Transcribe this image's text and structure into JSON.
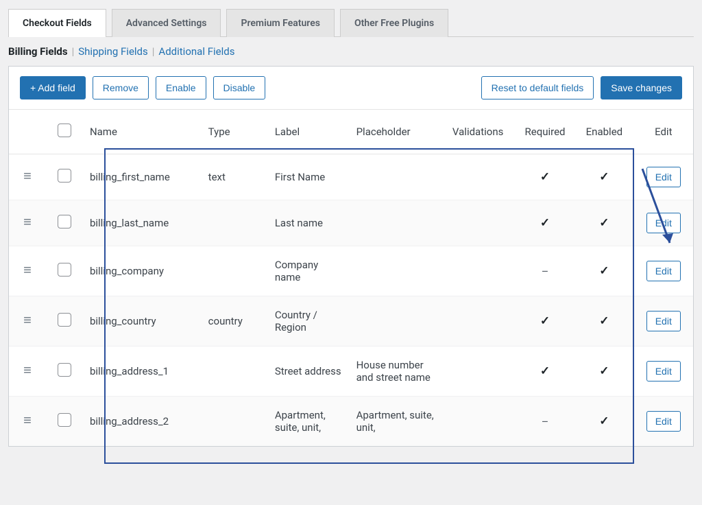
{
  "tabs": [
    {
      "label": "Checkout Fields",
      "active": true
    },
    {
      "label": "Advanced Settings",
      "active": false
    },
    {
      "label": "Premium Features",
      "active": false
    },
    {
      "label": "Other Free Plugins",
      "active": false
    }
  ],
  "subnav": {
    "current": "Billing Fields",
    "links": [
      "Shipping Fields",
      "Additional Fields"
    ]
  },
  "toolbar": {
    "add": "+ Add field",
    "remove": "Remove",
    "enable": "Enable",
    "disable": "Disable",
    "reset": "Reset to default fields",
    "save": "Save changes"
  },
  "columns": {
    "name": "Name",
    "type": "Type",
    "label": "Label",
    "placeholder": "Placeholder",
    "validations": "Validations",
    "required": "Required",
    "enabled": "Enabled",
    "edit": "Edit"
  },
  "edit_label": "Edit",
  "rows": [
    {
      "name": "billing_first_name",
      "type": "text",
      "label": "First Name",
      "placeholder": "",
      "required": "check",
      "enabled": "check"
    },
    {
      "name": "billing_last_name",
      "type": "",
      "label": "Last name",
      "placeholder": "",
      "required": "check",
      "enabled": "check"
    },
    {
      "name": "billing_company",
      "type": "",
      "label": "Company name",
      "placeholder": "",
      "required": "dash",
      "enabled": "check"
    },
    {
      "name": "billing_country",
      "type": "country",
      "label": "Country / Region",
      "placeholder": "",
      "required": "check",
      "enabled": "check"
    },
    {
      "name": "billing_address_1",
      "type": "",
      "label": "Street address",
      "placeholder": "House number and street name",
      "required": "check",
      "enabled": "check"
    },
    {
      "name": "billing_address_2",
      "type": "",
      "label": "Apartment, suite, unit,",
      "placeholder": "Apartment, suite, unit,",
      "required": "dash",
      "enabled": "check"
    }
  ]
}
